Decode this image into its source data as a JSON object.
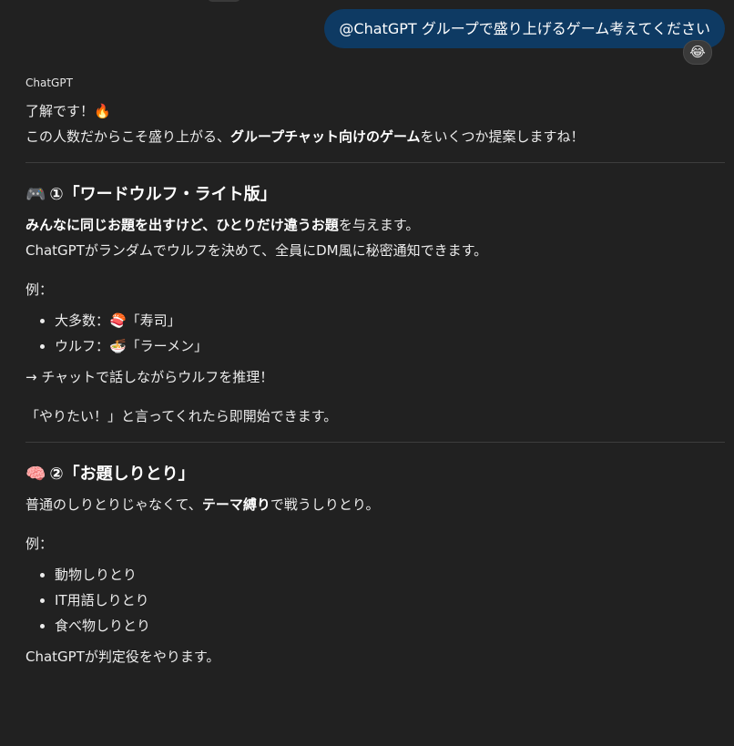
{
  "user_message": {
    "text": "@ChatGPT グループで盛り上げるゲーム考えてください",
    "reaction_emoji": "😂"
  },
  "assistant": {
    "sender": "ChatGPT",
    "intro_line1": "了解です！🔥",
    "intro_line2": {
      "pre": "この人数だからこそ盛り上がる、",
      "bold": "グループチャット向けのゲーム",
      "post": "をいくつか提案しますね！"
    },
    "games": [
      {
        "icon": "🎮",
        "title": "①「ワードウルフ・ライト版」",
        "desc_line1": {
          "bold1": "みんなに同じお題を出すけど、ひとりだけ違うお題",
          "post": "を与えます。"
        },
        "desc_line2": "ChatGPTがランダムでウルフを決めて、全員にDM風に秘密通知できます。",
        "example_label": "例：",
        "examples": [
          "大多数：🍣「寿司」",
          "ウルフ：🍜「ラーメン」"
        ],
        "note1": "→ チャットで話しながらウルフを推理！",
        "note2": "「やりたい！」と言ってくれたら即開始できます。"
      },
      {
        "icon": "🧠",
        "title": "②「お題しりとり」",
        "desc_line1": {
          "pre": "普通のしりとりじゃなくて、",
          "bold1": "テーマ縛り",
          "post": "で戦うしりとり。"
        },
        "example_label": "例：",
        "examples": [
          "動物しりとり",
          "IT用語しりとり",
          "食べ物しりとり"
        ],
        "note1": "ChatGPTが判定役をやります。"
      }
    ]
  },
  "colors": {
    "background": "#212121",
    "user_bubble": "#0e3a63",
    "text": "#ececec"
  }
}
